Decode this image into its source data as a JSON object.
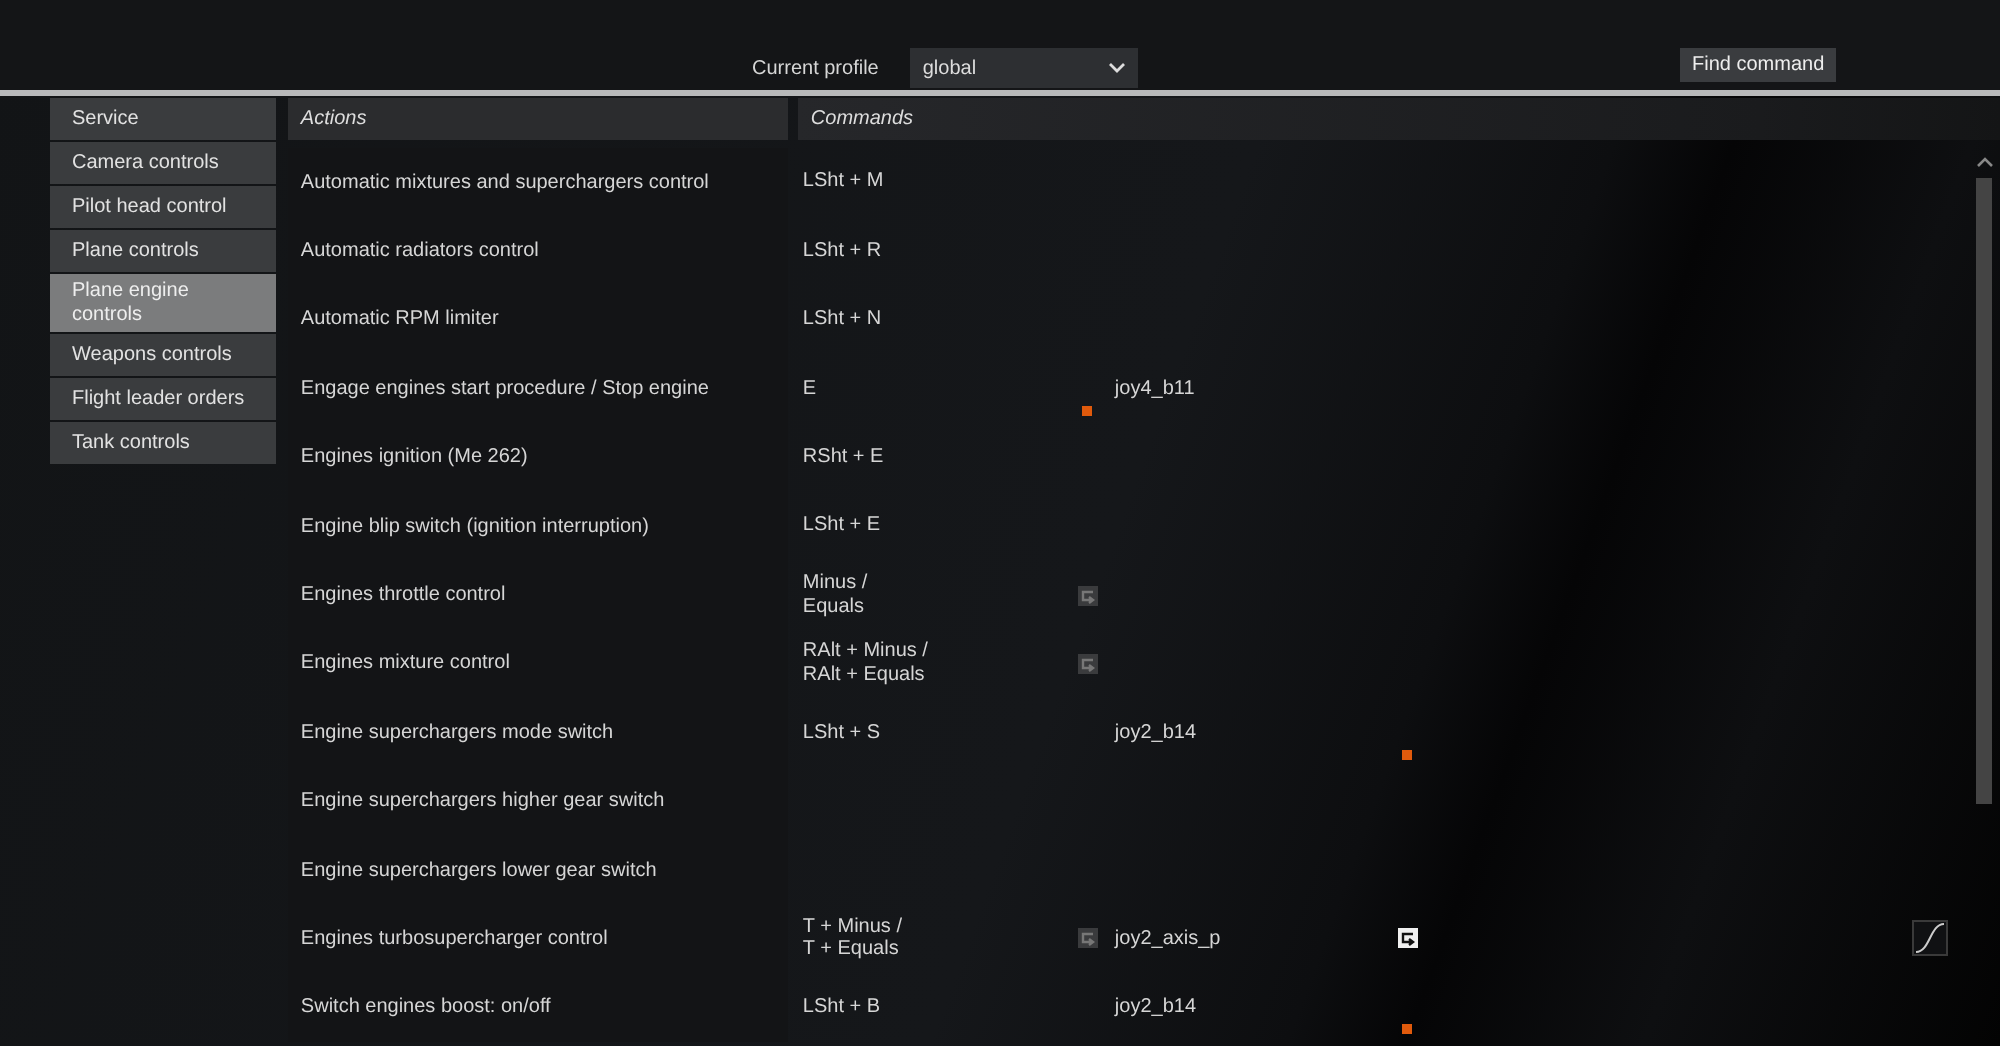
{
  "top_bar": {
    "profile_label": "Current profile",
    "profile_value": "global",
    "find_button": "Find command"
  },
  "sidebar": {
    "items": [
      {
        "label": "Service",
        "selected": false
      },
      {
        "label": "Camera controls",
        "selected": false
      },
      {
        "label": "Pilot head control",
        "selected": false
      },
      {
        "label": "Plane controls",
        "selected": false
      },
      {
        "label": "Plane engine controls",
        "selected": true
      },
      {
        "label": "Weapons controls",
        "selected": false
      },
      {
        "label": "Flight leader orders",
        "selected": false
      },
      {
        "label": "Tank controls",
        "selected": false
      }
    ]
  },
  "table": {
    "columns": [
      "Actions",
      "Commands"
    ],
    "rows": [
      {
        "action": "Automatic mixtures and superchargers control",
        "keys": [
          "LSht + M"
        ],
        "key_swap": false,
        "key_marker": false,
        "joy_swap": false,
        "joy_marker": false,
        "curve": false
      },
      {
        "action": "Automatic radiators control",
        "keys": [
          "LSht + R"
        ],
        "key_swap": false,
        "key_marker": false,
        "joy_swap": false,
        "joy_marker": false,
        "curve": false
      },
      {
        "action": "Automatic RPM limiter",
        "keys": [
          "LSht + N"
        ],
        "key_swap": false,
        "key_marker": false,
        "joy_swap": false,
        "joy_marker": false,
        "curve": false
      },
      {
        "action": "Engage engines start procedure / Stop engine",
        "keys": [
          "E"
        ],
        "key_swap": false,
        "key_marker": true,
        "joystick": "joy4_b11",
        "joy_swap": false,
        "joy_marker": false,
        "curve": false
      },
      {
        "action": "Engines ignition (Me 262)",
        "keys": [
          "RSht + E"
        ],
        "key_swap": false,
        "key_marker": false,
        "joy_swap": false,
        "joy_marker": false,
        "curve": false
      },
      {
        "action": "Engine blip switch (ignition interruption)",
        "keys": [
          "LSht + E"
        ],
        "key_swap": false,
        "key_marker": false,
        "joy_swap": false,
        "joy_marker": false,
        "curve": false
      },
      {
        "action": "Engines throttle control",
        "keys": [
          "Minus /",
          "Equals"
        ],
        "key_swap": true,
        "key_marker": false,
        "joy_swap": false,
        "joy_marker": false,
        "curve": false
      },
      {
        "action": "Engines mixture control",
        "keys": [
          "RAlt + Minus /",
          "RAlt + Equals"
        ],
        "key_swap": true,
        "key_marker": false,
        "joy_swap": false,
        "joy_marker": false,
        "curve": false
      },
      {
        "action": "Engine superchargers mode switch",
        "keys": [
          "LSht + S"
        ],
        "key_swap": false,
        "key_marker": false,
        "joystick": "joy2_b14",
        "joy_swap": false,
        "joy_marker": true,
        "curve": false
      },
      {
        "action": "Engine superchargers higher gear switch",
        "keys": [],
        "key_swap": false,
        "key_marker": false,
        "joy_swap": false,
        "joy_marker": false,
        "curve": false
      },
      {
        "action": "Engine superchargers lower gear switch",
        "keys": [],
        "key_swap": false,
        "key_marker": false,
        "joy_swap": false,
        "joy_marker": false,
        "curve": false
      },
      {
        "action": "Engines turbosupercharger control",
        "keys": [
          "T + Minus /",
          "T + Equals"
        ],
        "key_swap": true,
        "key_marker": false,
        "joystick": "joy2_axis_p",
        "joy_swap": true,
        "joy_marker": false,
        "curve": true
      },
      {
        "action": "Switch engines boost: on/off",
        "keys": [
          "LSht + B"
        ],
        "key_swap": false,
        "key_marker": false,
        "joystick": "joy2_b14",
        "joy_swap": false,
        "joy_marker": true,
        "curve": false
      }
    ]
  }
}
